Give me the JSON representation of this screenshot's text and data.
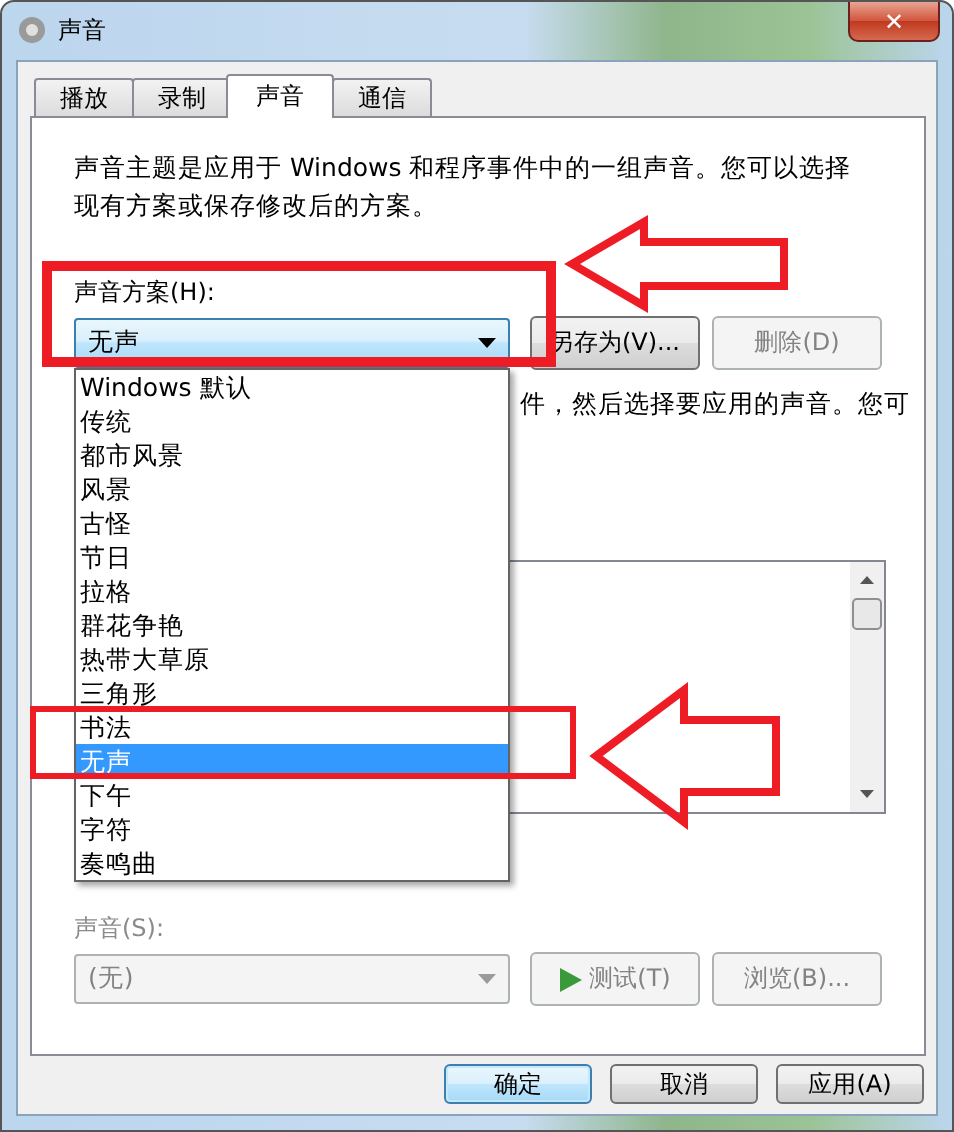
{
  "window": {
    "title": "声音",
    "close": "✕"
  },
  "tabs": [
    {
      "label": "播放",
      "selected": false
    },
    {
      "label": "录制",
      "selected": false
    },
    {
      "label": "声音",
      "selected": true
    },
    {
      "label": "通信",
      "selected": false
    }
  ],
  "description": "声音主题是应用于 Windows 和程序事件中的一组声音。您可以选择现有方案或保存修改后的方案。",
  "scheme": {
    "label": "声音方案(H):",
    "value": "无声",
    "expanded": true,
    "options": [
      {
        "label": "Windows 默认",
        "selected": false
      },
      {
        "label": "传统",
        "selected": false
      },
      {
        "label": "都市风景",
        "selected": false
      },
      {
        "label": "风景",
        "selected": false
      },
      {
        "label": "古怪",
        "selected": false
      },
      {
        "label": "节日",
        "selected": false
      },
      {
        "label": "拉格",
        "selected": false
      },
      {
        "label": "群花争艳",
        "selected": false
      },
      {
        "label": "热带大草原",
        "selected": false
      },
      {
        "label": "三角形",
        "selected": false
      },
      {
        "label": "书法",
        "selected": false
      },
      {
        "label": "无声",
        "selected": true
      },
      {
        "label": "下午",
        "selected": false
      },
      {
        "label": "字符",
        "selected": false
      },
      {
        "label": "奏鸣曲",
        "selected": false
      }
    ]
  },
  "scheme_buttons": [
    {
      "label": "另存为(V)...",
      "disabled": false
    },
    {
      "label": "删除(D)",
      "disabled": true
    }
  ],
  "events_hint": "件，然后选择要应用的声音。您可",
  "sound": {
    "label": "声音(S):",
    "value": "(无)",
    "disabled": true
  },
  "sound_buttons": [
    {
      "label": "测试(T)",
      "kind": "play",
      "disabled": true
    },
    {
      "label": "浏览(B)...",
      "kind": "plain",
      "disabled": true
    }
  ],
  "dialog_buttons": [
    {
      "label": "确定",
      "default": true
    },
    {
      "label": "取消",
      "default": false
    },
    {
      "label": "应用(A)",
      "default": false
    }
  ]
}
